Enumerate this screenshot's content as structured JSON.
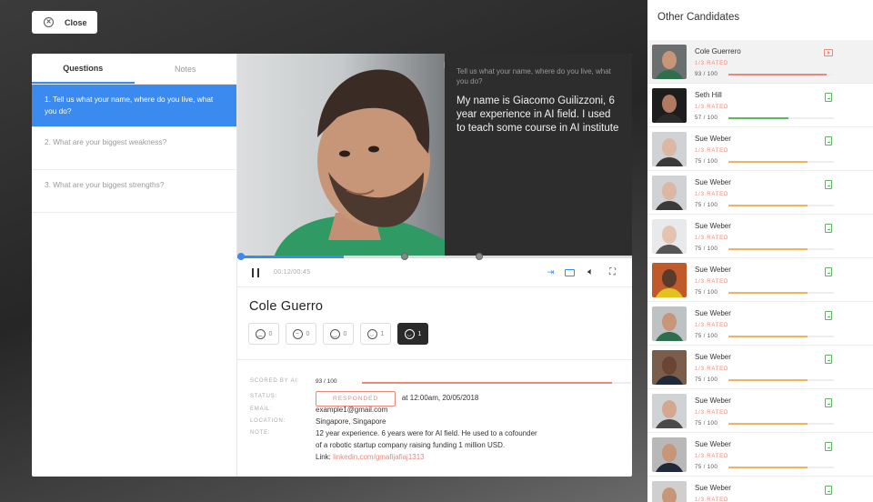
{
  "header": {
    "close_label": "Close"
  },
  "questions_panel": {
    "tabs": [
      {
        "label": "Questions",
        "active": true
      },
      {
        "label": "Notes",
        "active": false
      }
    ],
    "items": [
      {
        "text": "1. Tell us what your name, where do you live, what you do?",
        "active": true
      },
      {
        "text": "2. What are your biggest weakness?",
        "active": false
      },
      {
        "text": "3. What are your biggest strengths?",
        "active": false
      }
    ]
  },
  "video": {
    "subtitle_question": "Tell us what your name, where do you live, what you do?",
    "subtitle_answer": "My name is Giacomo Guilizzoni, 6 year experience in AI field. I used to teach some course in AI institute",
    "time": "00:12/00:45",
    "progress": 0.27
  },
  "candidate": {
    "name": "Cole Guerro",
    "reactions": [
      {
        "icon": "sad-face-icon",
        "count": "0",
        "active": false
      },
      {
        "icon": "neutral-face-icon",
        "count": "0",
        "active": false
      },
      {
        "icon": "smile-face-icon",
        "count": "0",
        "active": false
      },
      {
        "icon": "happy-face-icon",
        "count": "1",
        "active": false
      },
      {
        "icon": "love-face-icon",
        "count": "1",
        "active": true
      }
    ],
    "details": {
      "scored_label": "SCORED BY AI:",
      "scored_value": "93 / 100",
      "score_fraction": 0.93,
      "status_label": "STATUS:",
      "status_badge": "RESPONDED",
      "status_time": "at 12:00am, 20/05/2018",
      "email_label": "EMAIL:",
      "email_value": "example1@gmail.com",
      "location_label": "LOCATION:",
      "location_value": "Singapore, Singapore",
      "note_label": "NOTE:",
      "note_line1": "12 year experience. 6 years were for AI field. He used to a cofounder",
      "note_line2": "of a robotic startup company raising funding 1 million USD.",
      "link_prefix": "Link: ",
      "link_text": "linkedin.com/gmafijafiaj1313"
    }
  },
  "sidebar": {
    "title": "Other Candidates",
    "candidates": [
      {
        "name": "Cole Guerrero",
        "rated": "1/3 RATED",
        "score": "93 / 100",
        "fraction": 0.93,
        "bar_color": "#e8897c",
        "active": true,
        "icon": "video-icon"
      },
      {
        "name": "Seth Hill",
        "rated": "1/3 RATED",
        "score": "57 / 100",
        "fraction": 0.57,
        "bar_color": "#5cb85c",
        "active": false,
        "icon": "doc-icon"
      },
      {
        "name": "Sue Weber",
        "rated": "1/3 RATED",
        "score": "75 / 100",
        "fraction": 0.75,
        "bar_color": "#f0b462",
        "active": false,
        "icon": "doc-icon"
      },
      {
        "name": "Sue Weber",
        "rated": "1/3 RATED",
        "score": "75 / 100",
        "fraction": 0.75,
        "bar_color": "#f0b462",
        "active": false,
        "icon": "doc-icon"
      },
      {
        "name": "Sue Weber",
        "rated": "1/3 RATED",
        "score": "75 / 100",
        "fraction": 0.75,
        "bar_color": "#f0b462",
        "active": false,
        "icon": "doc-icon"
      },
      {
        "name": "Sue Weber",
        "rated": "1/3 RATED",
        "score": "75 / 100",
        "fraction": 0.75,
        "bar_color": "#f0b462",
        "active": false,
        "icon": "doc-icon"
      },
      {
        "name": "Sue Weber",
        "rated": "1/3 RATED",
        "score": "75 / 100",
        "fraction": 0.75,
        "bar_color": "#f0b462",
        "active": false,
        "icon": "doc-icon"
      },
      {
        "name": "Sue Weber",
        "rated": "1/3 RATED",
        "score": "75 / 100",
        "fraction": 0.75,
        "bar_color": "#f0b462",
        "active": false,
        "icon": "doc-icon"
      },
      {
        "name": "Sue Weber",
        "rated": "1/3 RATED",
        "score": "75 / 100",
        "fraction": 0.75,
        "bar_color": "#f0b462",
        "active": false,
        "icon": "doc-icon"
      },
      {
        "name": "Sue Weber",
        "rated": "1/3 RATED",
        "score": "75 / 100",
        "fraction": 0.75,
        "bar_color": "#f0b462",
        "active": false,
        "icon": "doc-icon"
      },
      {
        "name": "Sue Weber",
        "rated": "1/3 RATED",
        "score": "75 / 100",
        "fraction": 0.75,
        "bar_color": "#f0b462",
        "active": false,
        "icon": "doc-icon"
      }
    ]
  }
}
